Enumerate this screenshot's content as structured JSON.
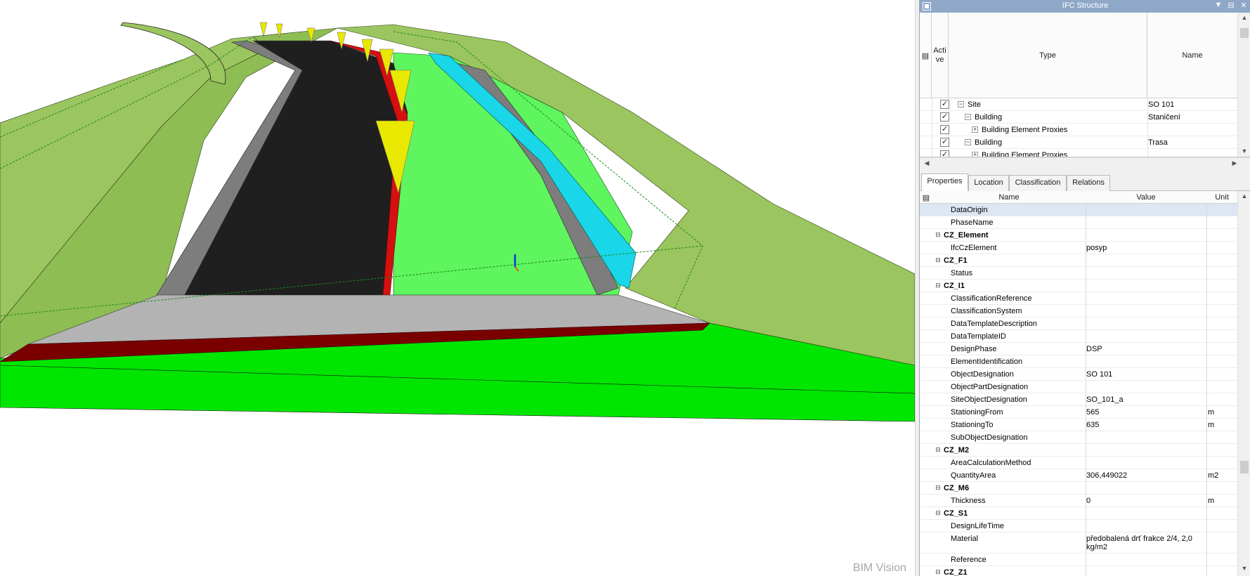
{
  "viewer": {
    "watermark": "BIM Vision"
  },
  "panel": {
    "title": "IFC Structure",
    "controls": {
      "dropdown": "▼",
      "pin": "⊟",
      "close": "✕"
    }
  },
  "tree": {
    "columns": {
      "active": "Acti\nve",
      "type": "Type",
      "name": "Name"
    },
    "rows": [
      {
        "label": "Site",
        "expander": "−",
        "name": "SO 101",
        "checked": "✓"
      },
      {
        "label": "Building",
        "expander": "−",
        "name": "Staničení",
        "checked": "✓"
      },
      {
        "label": "Building Element Proxies",
        "expander": "+",
        "name": "",
        "checked": "✓"
      },
      {
        "label": "Building",
        "expander": "−",
        "name": "Trasa",
        "checked": "✓"
      },
      {
        "label": "Building Element Proxies",
        "expander": "+",
        "name": "",
        "checked": "✓"
      }
    ]
  },
  "tabs": [
    {
      "label": "Properties",
      "active": true
    },
    {
      "label": "Location",
      "active": false
    },
    {
      "label": "Classification",
      "active": false
    },
    {
      "label": "Relations",
      "active": false
    }
  ],
  "properties": {
    "columns": {
      "name": "Name",
      "value": "Value",
      "unit": "Unit"
    },
    "rows": [
      {
        "kind": "prop",
        "name": "DataOrigin",
        "value": "",
        "unit": "",
        "selected": true
      },
      {
        "kind": "prop",
        "name": "PhaseName",
        "value": "",
        "unit": ""
      },
      {
        "kind": "group",
        "name": "CZ_Element"
      },
      {
        "kind": "prop",
        "name": "IfcCzElement",
        "value": "posyp",
        "unit": ""
      },
      {
        "kind": "group",
        "name": "CZ_F1"
      },
      {
        "kind": "prop",
        "name": "Status",
        "value": "",
        "unit": ""
      },
      {
        "kind": "group",
        "name": "CZ_I1"
      },
      {
        "kind": "prop",
        "name": "ClassificationReference",
        "value": "",
        "unit": ""
      },
      {
        "kind": "prop",
        "name": "ClassificationSystem",
        "value": "",
        "unit": ""
      },
      {
        "kind": "prop",
        "name": "DataTemplateDescription",
        "value": "",
        "unit": ""
      },
      {
        "kind": "prop",
        "name": "DataTemplateID",
        "value": "",
        "unit": ""
      },
      {
        "kind": "prop",
        "name": "DesignPhase",
        "value": "DSP",
        "unit": ""
      },
      {
        "kind": "prop",
        "name": "ElementIdentification",
        "value": "",
        "unit": ""
      },
      {
        "kind": "prop",
        "name": "ObjectDesignation",
        "value": "SO 101",
        "unit": ""
      },
      {
        "kind": "prop",
        "name": "ObjectPartDesignation",
        "value": "",
        "unit": ""
      },
      {
        "kind": "prop",
        "name": "SiteObjectDesignation",
        "value": "SO_101_a",
        "unit": ""
      },
      {
        "kind": "prop",
        "name": "StationingFrom",
        "value": "565",
        "unit": "m"
      },
      {
        "kind": "prop",
        "name": "StationingTo",
        "value": "635",
        "unit": "m"
      },
      {
        "kind": "prop",
        "name": "SubObjectDesignation",
        "value": "",
        "unit": ""
      },
      {
        "kind": "group",
        "name": "CZ_M2"
      },
      {
        "kind": "prop",
        "name": "AreaCalculationMethod",
        "value": "",
        "unit": ""
      },
      {
        "kind": "prop",
        "name": "QuantityArea",
        "value": "306,449022",
        "unit": "m2"
      },
      {
        "kind": "group",
        "name": "CZ_M6"
      },
      {
        "kind": "prop",
        "name": "Thickness",
        "value": "0",
        "unit": "m"
      },
      {
        "kind": "group",
        "name": "CZ_S1"
      },
      {
        "kind": "prop",
        "name": "DesignLifeTime",
        "value": "",
        "unit": ""
      },
      {
        "kind": "prop",
        "name": "Material",
        "value": "předobalená drť frakce 2/4, 2,0",
        "value2": "kg/m2",
        "unit": "",
        "tall": true
      },
      {
        "kind": "prop",
        "name": "Reference",
        "value": "",
        "unit": ""
      },
      {
        "kind": "group",
        "name": "CZ_Z1"
      }
    ]
  },
  "colors": {
    "titlebar": "#8fa8c8",
    "terrain": "#9bc55e",
    "road": "#1f1f1f",
    "verge": "#5ef55e",
    "ground": "#00e600",
    "barrier": "#19d6e8",
    "marker": "#e8e800",
    "kerb": "#d41010",
    "selectedRow": "#dde6f3"
  }
}
